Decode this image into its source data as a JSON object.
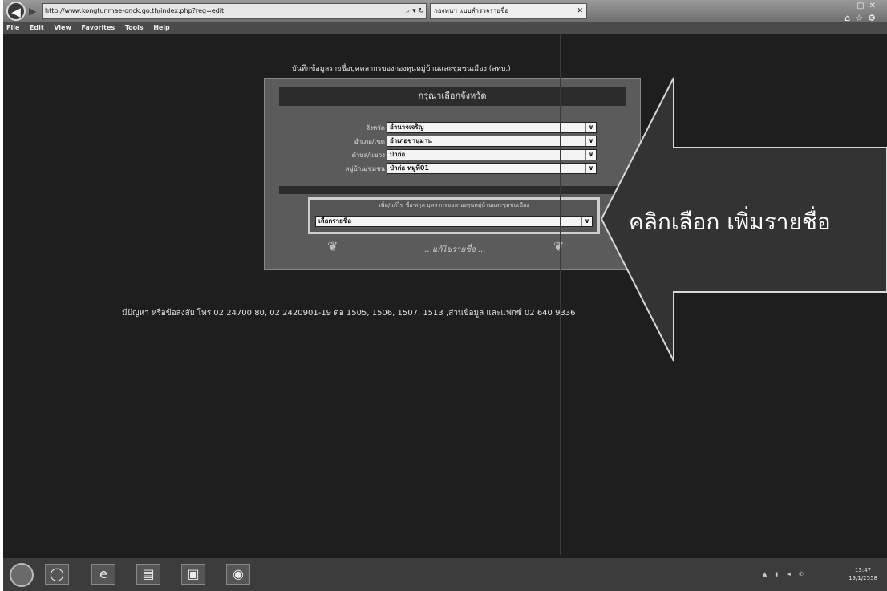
{
  "browser": {
    "url": "http://www.kongtunmae-onck.go.th/index.php?reg=edit",
    "tab_title": "กองทุนฯ แบบสำรวจรายชื่อ",
    "menu": [
      "File",
      "Edit",
      "View",
      "Favorites",
      "Tools",
      "Help"
    ]
  },
  "page": {
    "heading": "บันทึกข้อมูลรายชื่อบุคคลากรของกองทุนหมู่บ้านและชุมชนเมือง (สทบ.)",
    "panel_title": "กรุณาเลือกจังหวัด",
    "fields": [
      {
        "label": "จังหวัด",
        "value": "อำนาจเจริญ"
      },
      {
        "label": "อำเภอ/เขต",
        "value": "อำเภอชานุมาน"
      },
      {
        "label": "ตำบล/แขวง",
        "value": "ป่าก่อ"
      },
      {
        "label": "หมู่บ้าน/ชุมชน",
        "value": "ป่าก่อ หมู่ที่01"
      }
    ],
    "add_name_label": "เพิ่ม/แก้ไข ชื่อ-สกุล บุคลากรของกองทุนหมู่บ้านและชุมชนเมือง",
    "add_name_select": "เลือกรายชื่อ",
    "edit_link": "... แก้ไขรายชื่อ ...",
    "contact": "มีปัญหา หรือข้อสงสัย โทร 02 24700 80, 02 2420901-19 ต่อ 1505, 1506, 1507, 1513 ,ส่วนข้อมูล และแฟกซ์ 02 640 9336"
  },
  "annotation": {
    "callout_text": "คลิกเลือก เพิ่มรายชื่อ"
  },
  "taskbar": {
    "clock_time": "13:47",
    "clock_date": "19/1/2558"
  }
}
